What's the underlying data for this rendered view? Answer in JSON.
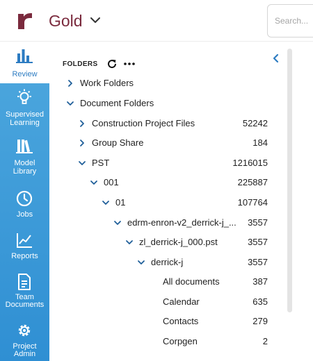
{
  "header": {
    "title": "Gold",
    "search_placeholder": "Search..."
  },
  "sidebar": {
    "items": [
      {
        "label": "Review",
        "icon": "bar-chart-icon"
      },
      {
        "label": "Supervised Learning",
        "label_1": "Supervised",
        "label_2": "Learning",
        "icon": "lightbulb-icon"
      },
      {
        "label": "Model Library",
        "label_1": "Model",
        "label_2": "Library",
        "icon": "books-icon"
      },
      {
        "label": "Jobs",
        "icon": "clock-icon"
      },
      {
        "label": "Reports",
        "icon": "line-chart-icon"
      },
      {
        "label": "Team Documents",
        "label_1": "Team",
        "label_2": "Documents",
        "icon": "document-icon"
      },
      {
        "label": "Project Admin",
        "label_1": "Project",
        "label_2": "Admin",
        "icon": "gear-icon"
      }
    ]
  },
  "panel": {
    "title": "FOLDERS"
  },
  "tree": [
    {
      "name": "Work Folders",
      "count": "",
      "expanded": false
    },
    {
      "name": "Document Folders",
      "count": "",
      "expanded": true
    },
    {
      "name": "Construction Project Files",
      "count": "52242",
      "expanded": false
    },
    {
      "name": "Group Share",
      "count": "184",
      "expanded": false
    },
    {
      "name": "PST",
      "count": "1216015",
      "expanded": true
    },
    {
      "name": "001",
      "count": "225887",
      "expanded": true
    },
    {
      "name": "01",
      "count": "107764",
      "expanded": true
    },
    {
      "name": "edrm-enron-v2_derrick-j_...",
      "count": "3557",
      "expanded": true
    },
    {
      "name": "zl_derrick-j_000.pst",
      "count": "3557",
      "expanded": true
    },
    {
      "name": "derrick-j",
      "count": "3557",
      "expanded": true
    },
    {
      "name": "All documents",
      "count": "387"
    },
    {
      "name": "Calendar",
      "count": "635"
    },
    {
      "name": "Contacts",
      "count": "279"
    },
    {
      "name": "Corpgen",
      "count": "2"
    }
  ],
  "colors": {
    "brand": "#7a2a3d",
    "sidebar": "#3a9ad9",
    "accent": "#2d7cc2"
  }
}
